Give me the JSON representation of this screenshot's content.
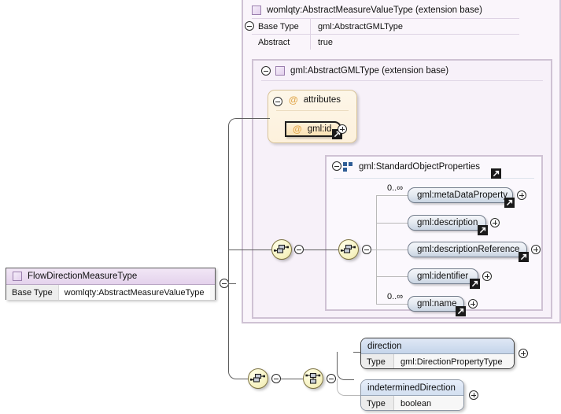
{
  "diagram": {
    "kind": "xml-schema-type-diagram",
    "root_type": {
      "name": "FlowDirectionMeasureType",
      "rows": [
        {
          "key": "Base Type",
          "value": "womlqty:AbstractMeasureValueType"
        }
      ]
    },
    "extension_bases": [
      {
        "title": "womlqty:AbstractMeasureValueType (extension base)",
        "rows": [
          {
            "key": "Base Type",
            "value": "gml:AbstractGMLType"
          },
          {
            "key": "Abstract",
            "value": "true"
          }
        ]
      },
      {
        "title": "gml:AbstractGMLType (extension base)"
      }
    ],
    "attribute_group": {
      "title": "attributes",
      "symbol": "@",
      "attributes": [
        {
          "name": "gml:id",
          "symbol": "@",
          "has_link": true,
          "expander": "plus"
        }
      ]
    },
    "model_group": {
      "title": "gml:StandardObjectProperties",
      "icon": "sequence-squares-icon",
      "has_link": true,
      "elements": [
        {
          "name": "gml:metaDataProperty",
          "occurs": "0..∞",
          "has_link": true,
          "expander": "plus"
        },
        {
          "name": "gml:description",
          "occurs": "",
          "has_link": true,
          "expander": "plus"
        },
        {
          "name": "gml:descriptionReference",
          "occurs": "",
          "has_link": true,
          "expander": "plus"
        },
        {
          "name": "gml:identifier",
          "occurs": "",
          "has_link": true,
          "expander": "plus"
        },
        {
          "name": "gml:name",
          "occurs": "0..∞",
          "has_link": true,
          "expander": "plus"
        }
      ]
    },
    "choice_branch": {
      "compositor_sequence": "sequence-icon",
      "compositor_choice": "choice-icon",
      "elements": [
        {
          "name": "direction",
          "rows": [
            {
              "key": "Type",
              "value": "gml:DirectionPropertyType"
            }
          ],
          "expander": "plus"
        },
        {
          "name": "indeterminedDirection",
          "rows": [
            {
              "key": "Type",
              "value": "boolean"
            }
          ],
          "expander": "plus"
        }
      ]
    },
    "colors": {
      "container_border": "#cfc2d4",
      "container_fill": "#faf5fb",
      "type_header": "#e4d2ec",
      "element_fill": "#c9d4e2",
      "attribute_fill": "#fae2b4",
      "compositor_fill": "#f7f3c4",
      "element_header_blue": "#c5d5ea",
      "line": "#5d5d5d"
    }
  }
}
